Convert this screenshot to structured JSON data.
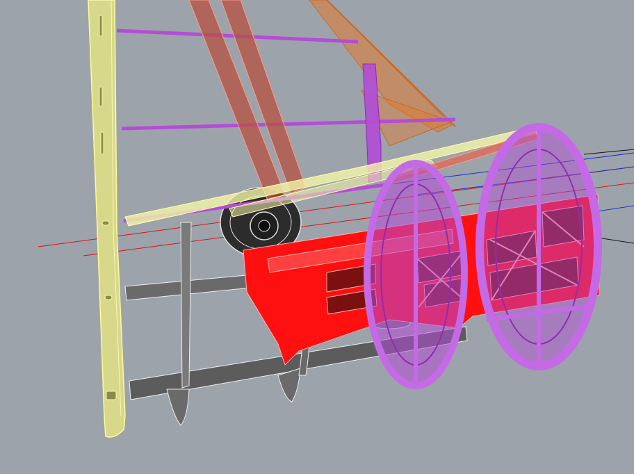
{
  "viewport": {
    "background": "#9da3ab",
    "projection": "perspective"
  },
  "scene": {
    "parts": [
      {
        "name": "wing-root-rib-side-panel",
        "color": "#f4f6a8"
      },
      {
        "name": "wing-spar",
        "color": "#b5503f"
      },
      {
        "name": "strut",
        "color": "#e07a2e"
      },
      {
        "name": "purple-stringer",
        "color": "#b34dd6"
      },
      {
        "name": "fuselage-former",
        "color": "#b34dd6"
      },
      {
        "name": "red-side-frame",
        "color": "#ff1010"
      },
      {
        "name": "grey-floor-plate",
        "color": "#6e6e6e"
      },
      {
        "name": "motor-mount",
        "color": "#3a3a3a"
      }
    ],
    "axes": [
      {
        "name": "x-axis",
        "color": "#e01010"
      },
      {
        "name": "y-axis",
        "color": "#1a30d0"
      }
    ]
  }
}
